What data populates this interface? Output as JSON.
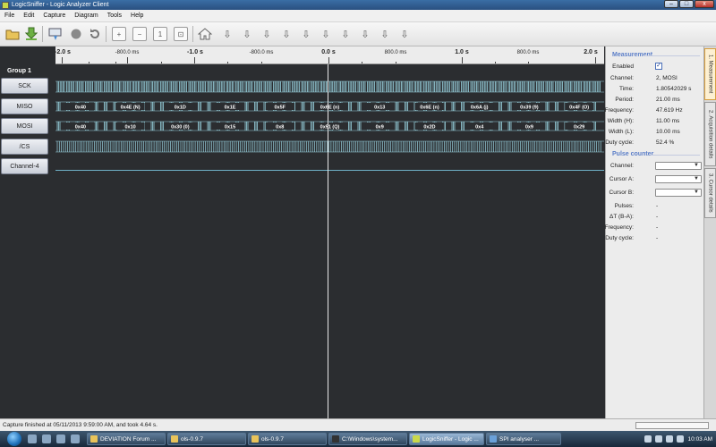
{
  "window": {
    "title": "LogicSniffer - Logic Analyzer Client",
    "controls": [
      "–",
      "□",
      "x"
    ]
  },
  "menu": [
    "File",
    "Edit",
    "Capture",
    "Diagram",
    "Tools",
    "Help"
  ],
  "timeline": {
    "major": [
      "-2.0 s",
      "-1.0 s",
      "0.0 s",
      "1.0 s",
      "2.0 s"
    ],
    "minor": [
      "-800.0 ms",
      "-800.0 ms",
      "800.0 ms",
      "800.0 ms"
    ]
  },
  "group": "Group 1",
  "channels": [
    "SCK",
    "MISO",
    "MOSI",
    "/CS",
    "Channel-4"
  ],
  "miso_labels": [
    "0x40",
    "0x4E (N)",
    "0x1D",
    "0x1E",
    "0x5F",
    "0x6E (n)",
    "0x13",
    "0x6E (n)",
    "0x6A (j)",
    "0x39 (9)",
    "0x4F (O)"
  ],
  "mosi_labels": [
    "0x40",
    "0x10",
    "0x30 (0)",
    "0x15",
    "0x8",
    "0x51 (Q)",
    "0x9",
    "0x2D",
    "0x4",
    "0x9",
    "0x29"
  ],
  "measurement": {
    "title": "Measurement",
    "enabled_label": "Enabled",
    "enabled_checked": true,
    "rows": [
      {
        "label": "Channel:",
        "value": "2, MOSI"
      },
      {
        "label": "Time:",
        "value": "1.80542029 s"
      },
      {
        "label": "Period:",
        "value": "21.00 ms"
      },
      {
        "label": "Frequency:",
        "value": "47.619 Hz"
      },
      {
        "label": "Width (H):",
        "value": "11.00 ms"
      },
      {
        "label": "Width (L):",
        "value": "10.00 ms"
      },
      {
        "label": "Duty cycle:",
        "value": "52.4 %"
      }
    ]
  },
  "pulse_counter": {
    "title": "Pulse counter",
    "selects": [
      {
        "label": "Channel:"
      },
      {
        "label": "Cursor A:"
      },
      {
        "label": "Cursor B:"
      }
    ],
    "rows": [
      {
        "label": "Pulses:",
        "value": "-"
      },
      {
        "label": "ΔT (B-A):",
        "value": "-"
      },
      {
        "label": "Frequency:",
        "value": "-"
      },
      {
        "label": "Duty cycle:",
        "value": "-"
      }
    ]
  },
  "tabs": [
    "1. Measurement",
    "2. Acquisition details",
    "3. Cursor details"
  ],
  "status": {
    "text": "Capture finished at 05/11/2013 9:59:00 AM, and took 4.64 s.",
    "progress": 0
  },
  "taskbar": {
    "tasks": [
      "DEVIATION Forum ...",
      "ols-0.9.7",
      "ols-0.9.7",
      "C:\\Windows\\system...",
      "LogicSniffer - Logic ...",
      "SPI analyser ..."
    ],
    "clock": "10:03 AM"
  },
  "colors": {
    "signal": "#9ad3e0",
    "panel_heading": "#5b7ec8",
    "background": "#2b2d30"
  }
}
